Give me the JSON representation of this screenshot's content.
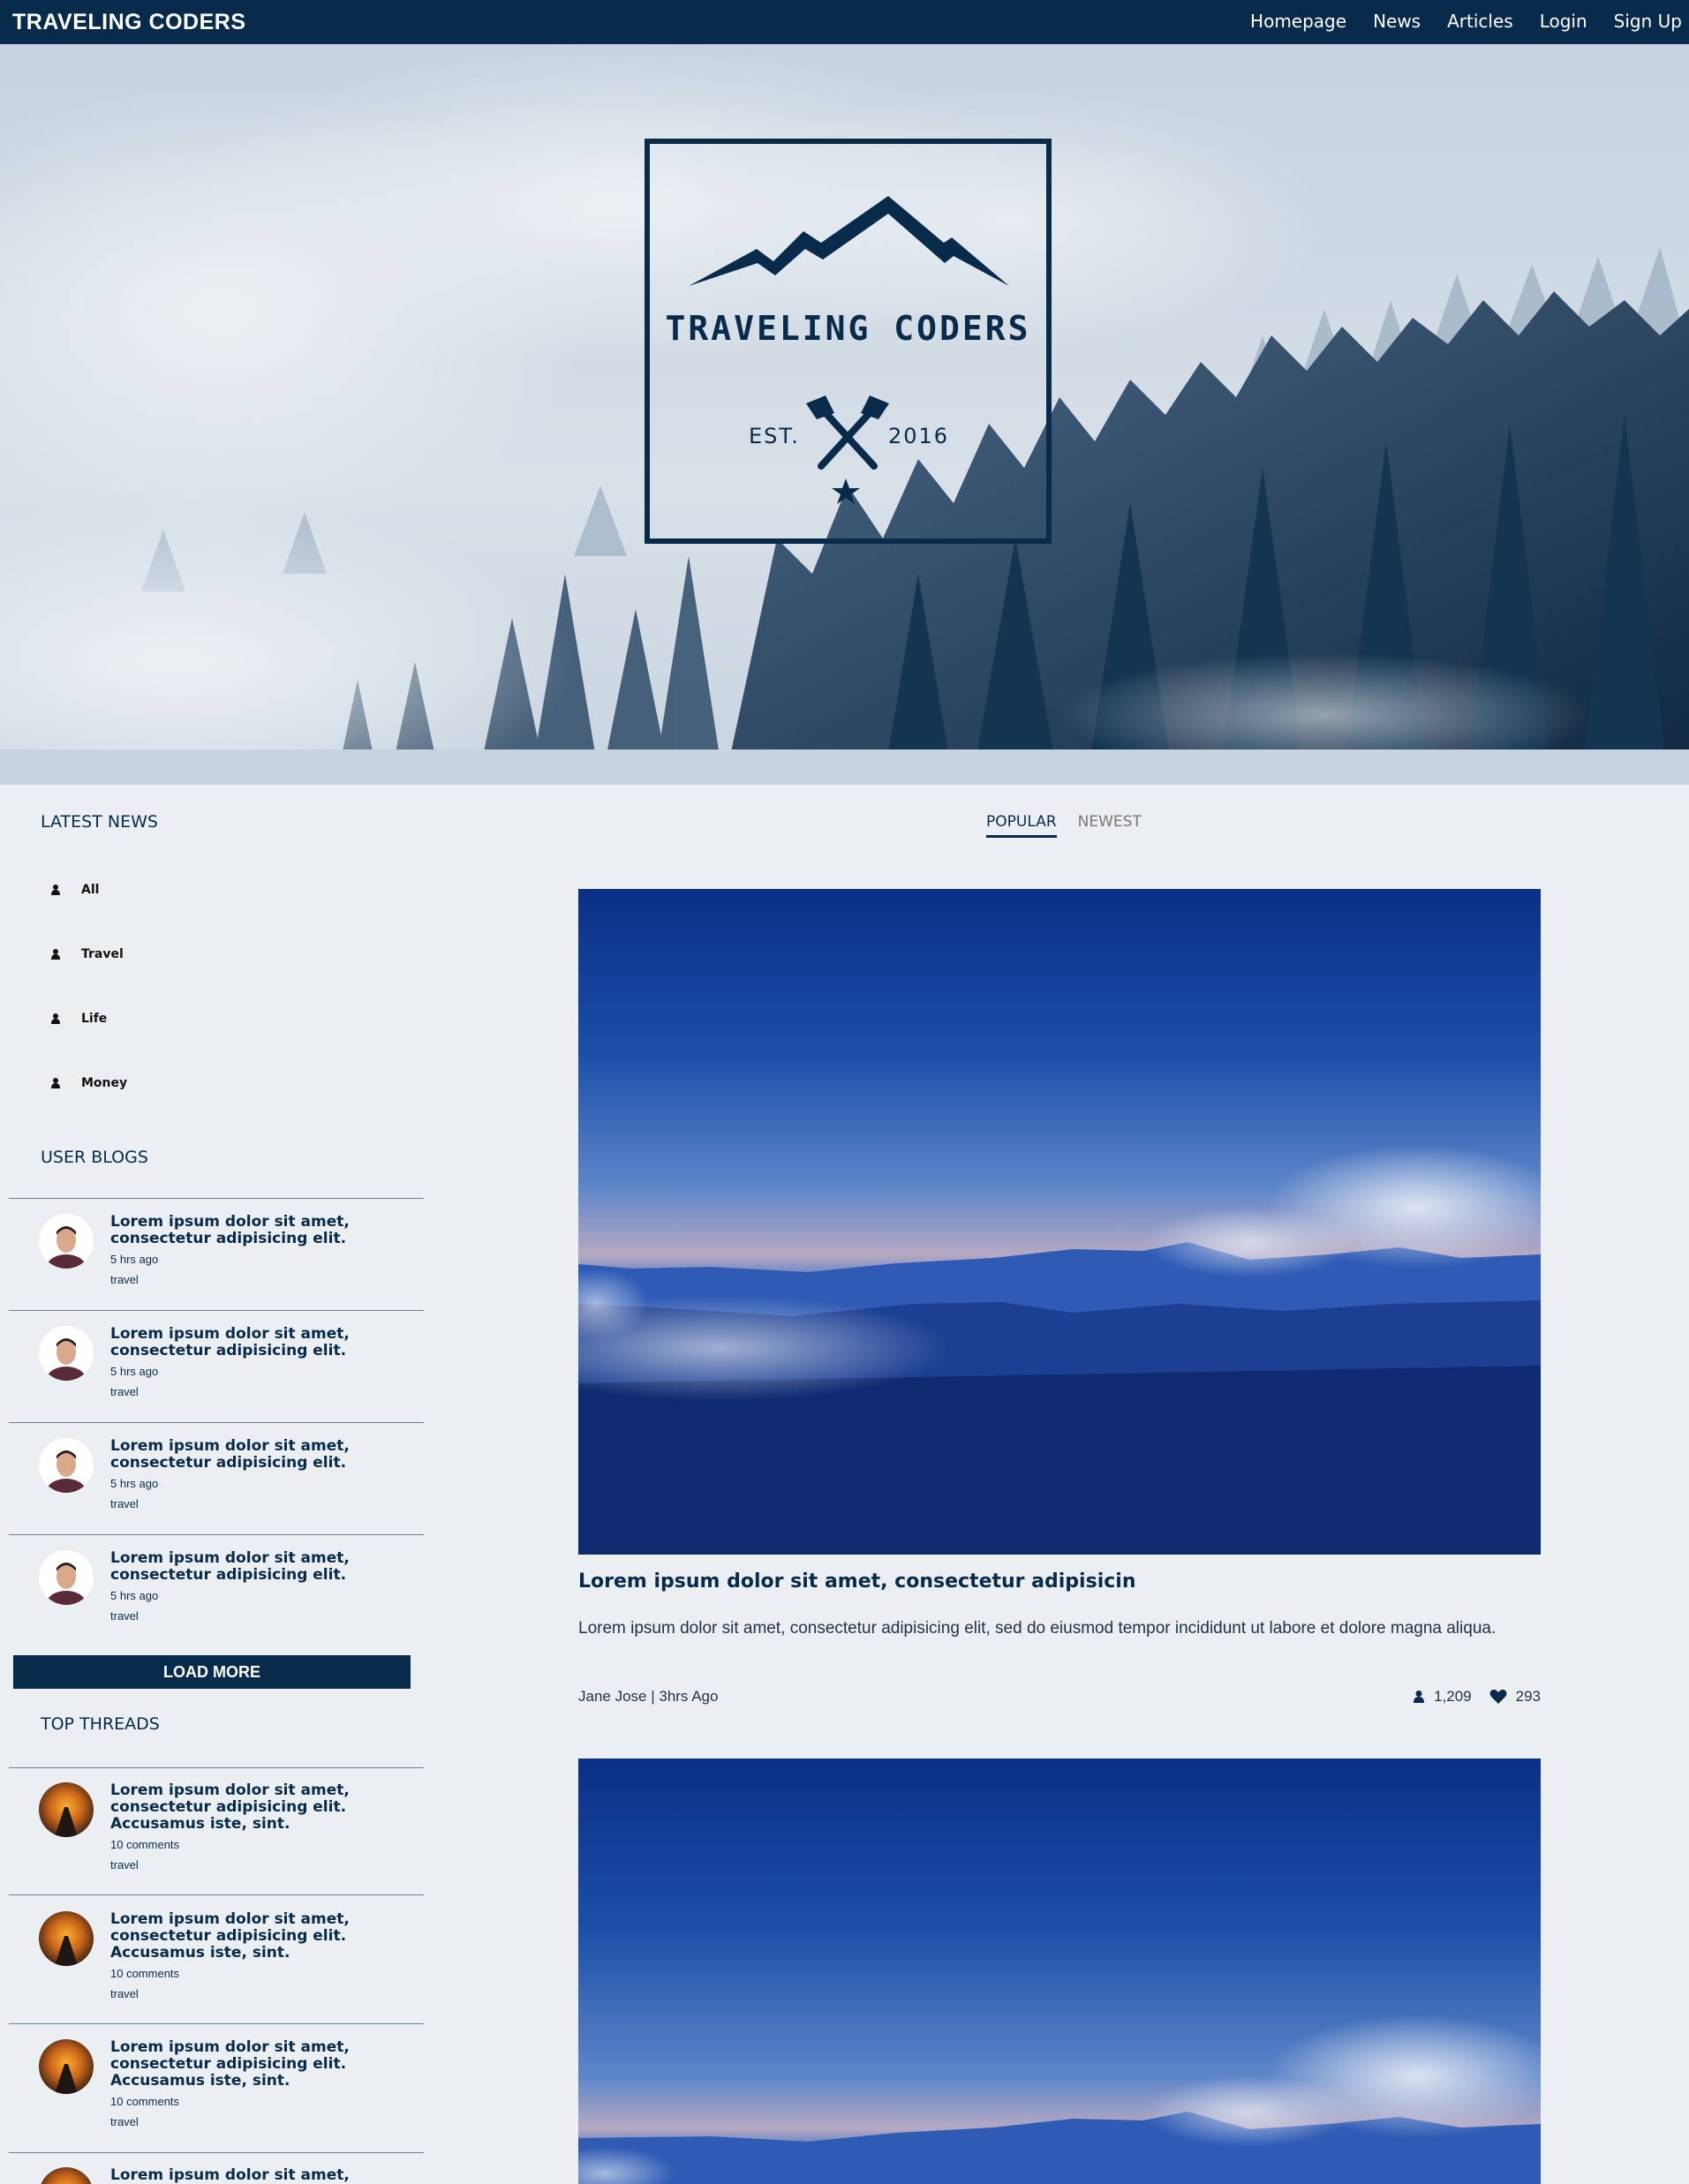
{
  "navbar": {
    "brand": "TRAVELING CODERS",
    "links": [
      "Homepage",
      "News",
      "Articles",
      "Login",
      "Sign Up"
    ]
  },
  "hero": {
    "logo_title": "TRAVELING CODERS",
    "est_label": "EST.",
    "est_year": "2016"
  },
  "sidebar": {
    "latest_news_title": "LATEST NEWS",
    "categories": [
      "All",
      "Travel",
      "Life",
      "Money"
    ],
    "user_blogs_title": "USER BLOGS",
    "user_blogs": [
      {
        "title": "Lorem ipsum dolor sit amet, consectetur adipisicing elit.",
        "time": "5 hrs ago",
        "tag": "travel"
      },
      {
        "title": "Lorem ipsum dolor sit amet, consectetur adipisicing elit.",
        "time": "5 hrs ago",
        "tag": "travel"
      },
      {
        "title": "Lorem ipsum dolor sit amet, consectetur adipisicing elit.",
        "time": "5 hrs ago",
        "tag": "travel"
      },
      {
        "title": "Lorem ipsum dolor sit amet, consectetur adipisicing elit.",
        "time": "5 hrs ago",
        "tag": "travel"
      }
    ],
    "load_more_label": "LOAD MORE",
    "top_threads_title": "TOP THREADS",
    "top_threads": [
      {
        "title": "Lorem ipsum dolor sit amet, consectetur adipisicing elit. Accusamus iste, sint.",
        "comments": "10 comments",
        "tag": "travel"
      },
      {
        "title": "Lorem ipsum dolor sit amet, consectetur adipisicing elit. Accusamus iste, sint.",
        "comments": "10 comments",
        "tag": "travel"
      },
      {
        "title": "Lorem ipsum dolor sit amet, consectetur adipisicing elit. Accusamus iste, sint.",
        "comments": "10 comments",
        "tag": "travel"
      },
      {
        "title": "Lorem ipsum dolor sit amet,"
      }
    ]
  },
  "main": {
    "tabs": [
      "POPULAR",
      "NEWEST"
    ],
    "article": {
      "title": "Lorem ipsum dolor sit amet, consectetur adipisicin",
      "body": "Lorem ipsum dolor sit amet, consectetur adipisicing elit, sed do eiusmod tempor incididunt ut labore et dolore magna aliqua.",
      "author": "Jane Jose | 3hrs Ago",
      "views": "1,209",
      "likes": "293"
    }
  },
  "icons": {
    "category": "user-icon",
    "views": "user-icon",
    "likes": "heart-icon"
  },
  "colors": {
    "navy": "#082b4c",
    "background": "#eceff2"
  }
}
